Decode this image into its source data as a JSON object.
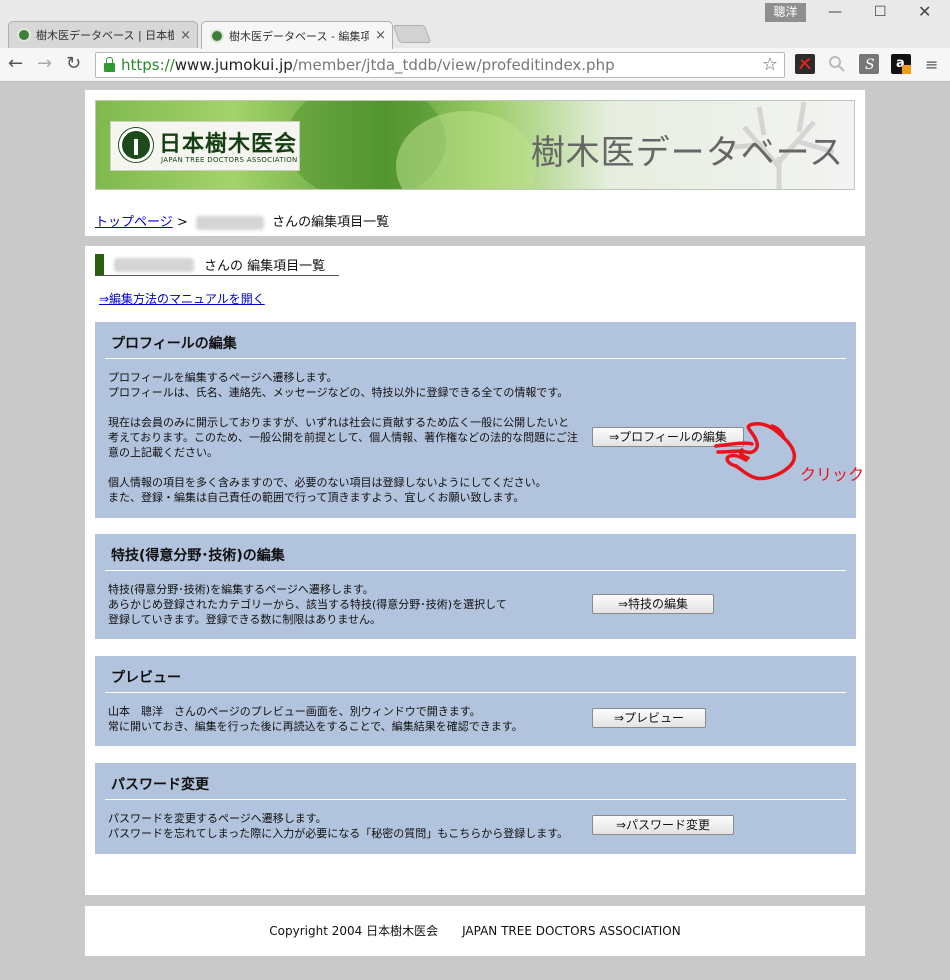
{
  "browser": {
    "tabs": [
      {
        "title": "樹木医データベース | 日本樹",
        "active": false
      },
      {
        "title": "樹木医データベース - 編集項",
        "active": true
      }
    ],
    "user_badge": "聰洋",
    "url": {
      "scheme": "https://",
      "host": "www.jumokui.jp",
      "path": "/member/jtda_tddb/view/profeditindex.php"
    }
  },
  "header": {
    "logo_jp": "日本樹木医会",
    "logo_en": "JAPAN TREE DOCTORS ASSOCIATION",
    "banner_title": "樹木医データベース"
  },
  "breadcrumb": {
    "top_link": "トップページ",
    "separator": ">",
    "current_suffix": "さんの編集項目一覧"
  },
  "page": {
    "heading_suffix": "さんの 編集項目一覧",
    "manual_link": "⇒編集方法のマニュアルを開く"
  },
  "sections": {
    "profile": {
      "title": "プロフィールの編集",
      "lines": [
        " プロフィールを編集するページへ遷移します。",
        "プロフィールは、氏名、連絡先、メッセージなどの、特技以外に登録できる全ての情報です。",
        "",
        "現在は会員のみに開示しておりますが、いずれは社会に貢献するため広く一般に公開したいと",
        "考えております。このため、一般公開を前提として、個人情報、著作権などの法的な問題にご注",
        "意の上記載ください。",
        "",
        "個人情報の項目を多く含みますので、必要のない項目は登録しないようにしてください。",
        "また、登録・編集は自己責任の範囲で行って頂きますよう、宜しくお願い致します。"
      ],
      "button": "⇒プロフィールの編集"
    },
    "skills": {
      "title": "特技(得意分野･技術)の編集",
      "lines": [
        " 特技(得意分野･技術)を編集するページへ遷移します。",
        "あらかじめ登録されたカテゴリーから、該当する特技(得意分野･技術)を選択して",
        "登録していきます。登録できる数に制限はありません。"
      ],
      "button": "⇒特技の編集"
    },
    "preview": {
      "title": "プレビュー",
      "lines": [
        " 山本　聰洋　さんのページのプレビュー画面を、別ウィンドウで開きます。",
        "常に開いておき、編集を行った後に再読込をすることで、編集結果を確認できます。"
      ],
      "button": "⇒プレビュー"
    },
    "password": {
      "title": "パスワード変更",
      "lines": [
        " パスワードを変更するページへ遷移します。",
        "パスワードを忘れてしまった際に入力が必要になる「秘密の質問」もこちらから登録します。"
      ],
      "button": "⇒パスワード変更"
    }
  },
  "annotation": {
    "click_label": "クリック",
    "color": "#e8141c"
  },
  "footer": {
    "copyright": "Copyright 2004 日本樹木医会　　JAPAN TREE DOCTORS ASSOCIATION"
  },
  "colors": {
    "card_bg": "#b2c3dd",
    "heading_bar": "#275f0f",
    "link": "#0000cc"
  }
}
